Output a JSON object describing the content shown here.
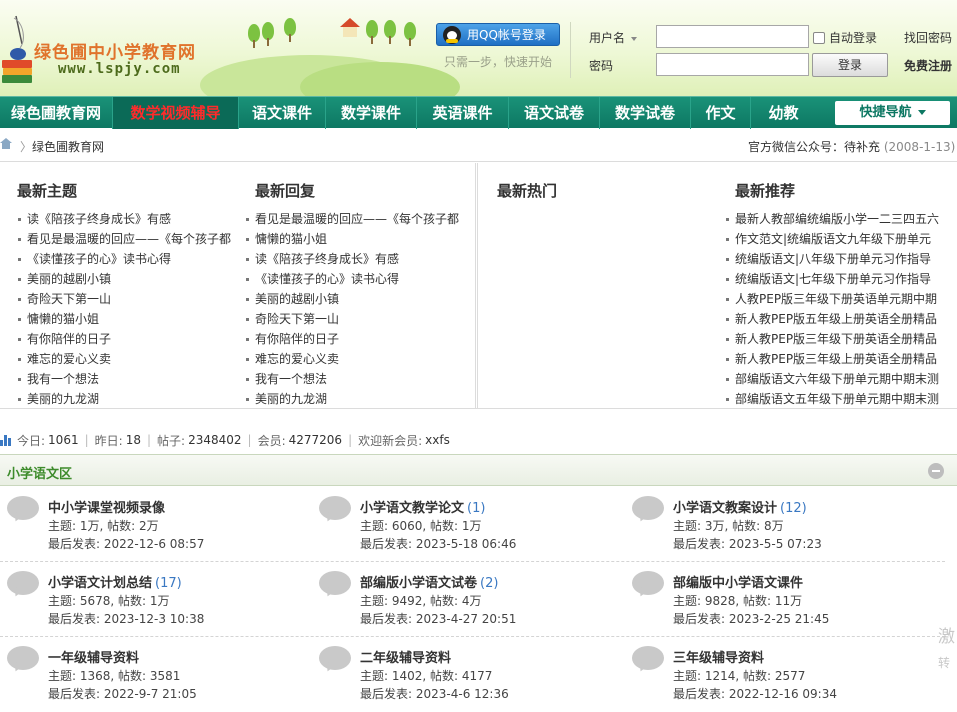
{
  "header": {
    "site_name": "绿色圃中小学教育网",
    "site_url": "www.lspjy.com",
    "qq_login_label": "用QQ帐号登录",
    "qq_hint": "只需一步，快速开始",
    "username_label": "用户名",
    "password_label": "密码",
    "username_value": "",
    "password_value": "",
    "auto_login_label": "自动登录",
    "login_button": "登录",
    "find_password": "找回密码",
    "register": "免费注册"
  },
  "nav": {
    "items": [
      {
        "label": "绿色圃教育网",
        "active": false
      },
      {
        "label": "数学视频辅导",
        "active": true
      },
      {
        "label": "语文课件",
        "active": false
      },
      {
        "label": "数学课件",
        "active": false
      },
      {
        "label": "英语课件",
        "active": false
      },
      {
        "label": "语文试卷",
        "active": false
      },
      {
        "label": "数学试卷",
        "active": false
      },
      {
        "label": "作文",
        "active": false
      },
      {
        "label": "幼教",
        "active": false
      }
    ],
    "quick_nav": "快捷导航"
  },
  "breadcrumb": {
    "separator": "〉",
    "current": "绿色圃教育网",
    "wechat_label": "官方微信公众号：待补充",
    "wechat_date": "(2008-1-13)"
  },
  "panels": {
    "latest_topics": {
      "title": "最新主题",
      "items": [
        "读《陪孩子终身成长》有感",
        "看见是最温暖的回应——《每个孩子都",
        "《读懂孩子的心》读书心得",
        "美丽的越剧小镇",
        "奇险天下第一山",
        "慵懒的猫小姐",
        "有你陪伴的日子",
        "难忘的爱心义卖",
        "我有一个想法",
        "美丽的九龙湖"
      ]
    },
    "latest_replies": {
      "title": "最新回复",
      "items": [
        "看见是最温暖的回应——《每个孩子都",
        "慵懒的猫小姐",
        "读《陪孩子终身成长》有感",
        "《读懂孩子的心》读书心得",
        "美丽的越剧小镇",
        "奇险天下第一山",
        "有你陪伴的日子",
        "难忘的爱心义卖",
        "我有一个想法",
        "美丽的九龙湖"
      ]
    },
    "hot": {
      "title": "最新热门",
      "items": []
    },
    "recommend": {
      "title": "最新推荐",
      "items": [
        "最新人教部编统编版小学一二三四五六",
        "作文范文|统编版语文九年级下册单元",
        "统编版语文|八年级下册单元习作指导",
        "统编版语文|七年级下册单元习作指导",
        "人教PEP版三年级下册英语单元期中期",
        "新人教PEP版五年级上册英语全册精品",
        "新人教PEP版三年级下册英语全册精品",
        "新人教PEP版三年级上册英语全册精品",
        "部编版语文六年级下册单元期中期末测",
        "部编版语文五年级下册单元期中期末测"
      ]
    }
  },
  "stats": {
    "today_label": "今日:",
    "today": "1061",
    "yesterday_label": "昨日:",
    "yesterday": "18",
    "posts_label": "帖子:",
    "posts": "2348402",
    "members_label": "会员:",
    "members": "4277206",
    "welcome_label": "欢迎新会员:",
    "new_member": "xxfs"
  },
  "section": {
    "title": "小学语文区",
    "forums": [
      {
        "name": "中小学课堂视频录像",
        "new": "",
        "meta": "主题: 1万, 帖数: 2万",
        "last": "最后发表: 2022-12-6 08:57"
      },
      {
        "name": "小学语文教学论文",
        "new": "(1)",
        "meta": "主题: 6060, 帖数: 1万",
        "last": "最后发表: 2023-5-18 06:46"
      },
      {
        "name": "小学语文教案设计",
        "new": "(12)",
        "meta": "主题: 3万, 帖数: 8万",
        "last": "最后发表: 2023-5-5 07:23"
      },
      {
        "name": "小学语文计划总结",
        "new": "(17)",
        "meta": "主题: 5678, 帖数: 1万",
        "last": "最后发表: 2023-12-3 10:38"
      },
      {
        "name": "部编版小学语文试卷",
        "new": "(2)",
        "meta": "主题: 9492, 帖数: 4万",
        "last": "最后发表: 2023-4-27 20:51"
      },
      {
        "name": "部编版中小学语文课件",
        "new": "",
        "meta": "主题: 9828, 帖数: 11万",
        "last": "最后发表: 2023-2-25 21:45"
      },
      {
        "name": "一年级辅导资料",
        "new": "",
        "meta": "主题: 1368, 帖数: 3581",
        "last": "最后发表: 2022-9-7 21:05"
      },
      {
        "name": "二年级辅导资料",
        "new": "",
        "meta": "主题: 1402, 帖数: 4177",
        "last": "最后发表: 2023-4-6 12:36"
      },
      {
        "name": "三年级辅导资料",
        "new": "",
        "meta": "主题: 1214, 帖数: 2577",
        "last": "最后发表: 2022-12-16 09:34"
      }
    ]
  },
  "side_ad": {
    "line1": "激",
    "line2": "转"
  }
}
